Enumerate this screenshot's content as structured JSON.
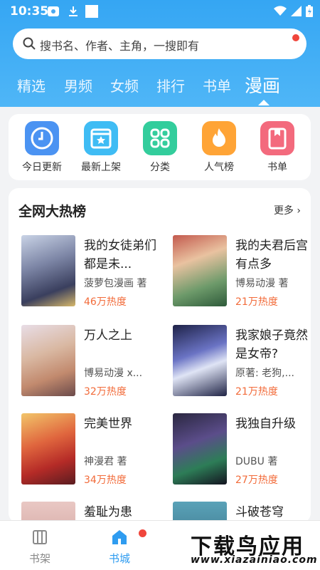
{
  "status": {
    "time": "10:35"
  },
  "search": {
    "placeholder": "搜书名、作者、主角，一搜即有"
  },
  "tabs": [
    {
      "label": "精选"
    },
    {
      "label": "男频"
    },
    {
      "label": "女频"
    },
    {
      "label": "排行"
    },
    {
      "label": "书单"
    },
    {
      "label": "漫画",
      "active": true
    }
  ],
  "quick": [
    {
      "label": "今日更新",
      "icon": "clock-icon",
      "color": "#3d8bf0"
    },
    {
      "label": "最新上架",
      "icon": "star-box-icon",
      "color": "#38b8f3"
    },
    {
      "label": "分类",
      "icon": "grid-icon",
      "color": "#2fcc9a"
    },
    {
      "label": "人气榜",
      "icon": "fire-icon",
      "color": "#ff9f2e"
    },
    {
      "label": "书单",
      "icon": "bookmark-book-icon",
      "color": "#f06478"
    }
  ],
  "hot": {
    "title": "全网大热榜",
    "more": "更多",
    "books": [
      {
        "title": "我的女徒弟们都是未...",
        "author": "菠萝包漫画 著",
        "heat": "46万热度"
      },
      {
        "title": "我的夫君后宫有点多",
        "author": "博易动漫 著",
        "heat": "21万热度"
      },
      {
        "title": "万人之上",
        "author": "博易动漫 x...",
        "heat": "32万热度"
      },
      {
        "title": "我家娘子竟然是女帝?",
        "author": "原著: 老狗,...",
        "heat": "21万热度"
      },
      {
        "title": "完美世界",
        "author": "神漫君 著",
        "heat": "34万热度"
      },
      {
        "title": "我独自升级",
        "author": "DUBU 著",
        "heat": "27万热度"
      },
      {
        "title": "羞耻为患",
        "author": "",
        "heat": ""
      },
      {
        "title": "斗破苍穹",
        "author": "",
        "heat": ""
      }
    ]
  },
  "nav": [
    {
      "label": "书架",
      "icon": "bookshelf-icon",
      "active": false
    },
    {
      "label": "书城",
      "icon": "store-icon",
      "active": true
    }
  ],
  "watermark": {
    "top": "下载鸟应用",
    "bottom": "www.xiazainiao.com"
  },
  "colors": {
    "primary": "#35a6f3",
    "heat": "#f26b3a",
    "badge": "#f0463c"
  }
}
